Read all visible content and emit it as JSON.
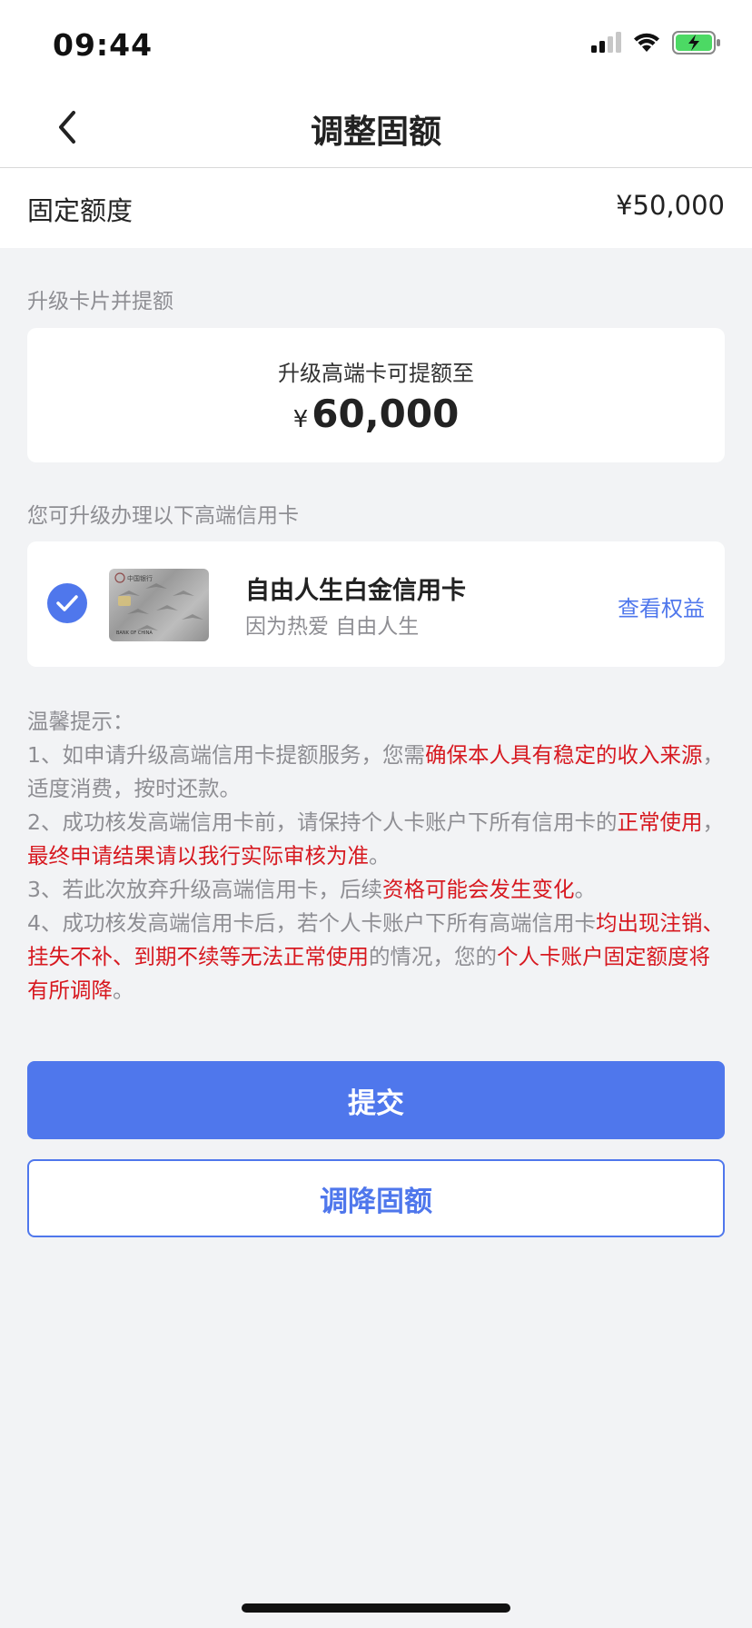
{
  "status_bar": {
    "time": "09:44"
  },
  "nav": {
    "title": "调整固额"
  },
  "fixed_limit": {
    "label": "固定额度",
    "value": "¥50,000"
  },
  "upgrade_section": {
    "label": "升级卡片并提额",
    "caption": "升级高端卡可提额至",
    "currency": "¥",
    "amount": "60,000"
  },
  "cards_section": {
    "label": "您可升级办理以下高端信用卡",
    "card": {
      "name": "自由人生白金信用卡",
      "slogan": "因为热爱 自由人生",
      "link": "查看权益",
      "thumb_bank_text": "中国银行",
      "thumb_card_text": "BANK OF CHINA"
    }
  },
  "tips": {
    "title": "温馨提示：",
    "t1_a": "1、如申请升级高端信用卡提额服务，您需",
    "t1_b": "确保本人具有稳定的收入来源",
    "t1_c": "，适度消费，按时还款。",
    "t2_a": "2、成功核发高端信用卡前，请保持个人卡账户下所有信用卡的",
    "t2_b": "正常使用",
    "t2_c": "，",
    "t2_d": "最终申请结果请以我行实际审核为准",
    "t2_e": "。",
    "t3_a": "3、若此次放弃升级高端信用卡，后续",
    "t3_b": "资格可能会发生变化",
    "t3_c": "。",
    "t4_a": "4、成功核发高端信用卡后，若个人卡账户下所有高端信用卡",
    "t4_b": "均出现注销、挂失不补、到期不续等无法正常使用",
    "t4_c": "的情况，您的",
    "t4_d": "个人卡账户固定额度将有所调降",
    "t4_e": "。"
  },
  "buttons": {
    "submit": "提交",
    "lower": "调降固额"
  },
  "colors": {
    "accent": "#4f77ec",
    "warning": "#d71920",
    "muted": "#8e8e93"
  }
}
